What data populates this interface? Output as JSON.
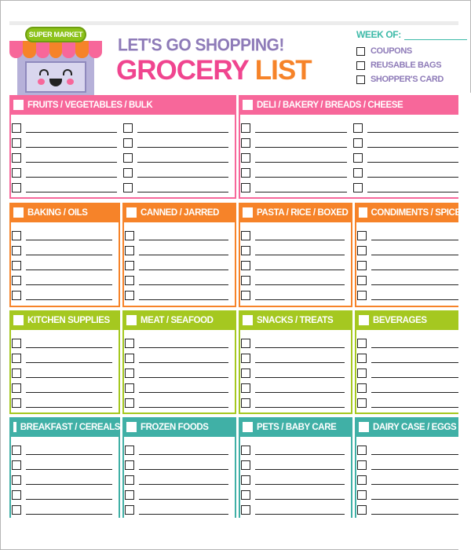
{
  "header": {
    "store_sign": "SUPER MARKET",
    "subtitle": "LET'S GO SHOPPING!",
    "title_part1": "GROCERY",
    "title_part2": "LIST",
    "week_of_label": "WEEK OF:",
    "week_of_value": "",
    "extras": [
      {
        "label": "COUPONS",
        "checked": false
      },
      {
        "label": "REUSABLE BAGS",
        "checked": false
      },
      {
        "label": "SHOPPER'S CARD",
        "checked": false
      }
    ]
  },
  "colors": {
    "pink": "#f7679a",
    "orange": "#f68329",
    "green": "#a5c820",
    "teal": "#40b0a6",
    "title_purple": "#8e7bb8",
    "title_pink": "#f0458f",
    "week_teal": "#3dbaa8"
  },
  "sections": [
    {
      "label": "FRUITS / VEGETABLES / BULK",
      "color": "pink",
      "columns": 2,
      "rows_per_column": 5
    },
    {
      "label": "DELI / BAKERY / BREADS / CHEESE",
      "color": "pink",
      "columns": 2,
      "rows_per_column": 5
    },
    {
      "label": "BAKING / OILS",
      "color": "orange",
      "columns": 1,
      "rows_per_column": 5
    },
    {
      "label": "CANNED / JARRED",
      "color": "orange",
      "columns": 1,
      "rows_per_column": 5
    },
    {
      "label": "PASTA / RICE / BOXED",
      "color": "orange",
      "columns": 1,
      "rows_per_column": 5
    },
    {
      "label": "CONDIMENTS / SPICES",
      "color": "orange",
      "columns": 1,
      "rows_per_column": 5
    },
    {
      "label": "KITCHEN SUPPLIES",
      "color": "green",
      "columns": 1,
      "rows_per_column": 5
    },
    {
      "label": "MEAT / SEAFOOD",
      "color": "green",
      "columns": 1,
      "rows_per_column": 5
    },
    {
      "label": "SNACKS / TREATS",
      "color": "green",
      "columns": 1,
      "rows_per_column": 5
    },
    {
      "label": "BEVERAGES",
      "color": "green",
      "columns": 1,
      "rows_per_column": 5
    },
    {
      "label": "BREAKFAST / CEREALS",
      "color": "teal",
      "columns": 1,
      "rows_per_column": 5
    },
    {
      "label": "FROZEN FOODS",
      "color": "teal",
      "columns": 1,
      "rows_per_column": 5
    },
    {
      "label": "PETS / BABY CARE",
      "color": "teal",
      "columns": 1,
      "rows_per_column": 5
    },
    {
      "label": "DAIRY CASE / EGGS",
      "color": "teal",
      "columns": 1,
      "rows_per_column": 5
    }
  ]
}
